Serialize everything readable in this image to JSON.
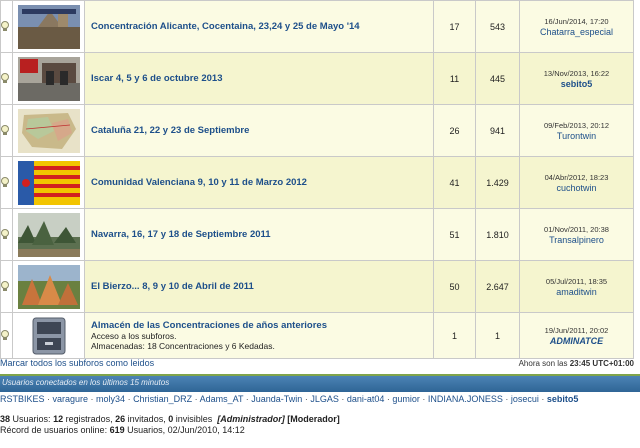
{
  "rows": [
    {
      "title": "Concentración Alicante, Cocentaina, 23,24 y 25 de Mayo '14",
      "topics": "17",
      "posts": "543",
      "date": "16/Jun/2014, 17:20",
      "user": "Chatarra_especial"
    },
    {
      "title": "Iscar 4, 5 y 6 de octubre 2013",
      "topics": "11",
      "posts": "445",
      "date": "13/Nov/2013, 16:22",
      "user": "sebito5"
    },
    {
      "title": "Cataluña 21, 22 y 23 de Septiembre",
      "topics": "26",
      "posts": "941",
      "date": "09/Feb/2013, 20:12",
      "user": "Turontwin"
    },
    {
      "title": "Comunidad Valenciana 9, 10 y 11 de Marzo 2012",
      "topics": "41",
      "posts": "1.429",
      "date": "04/Abr/2012, 18:23",
      "user": "cuchotwin"
    },
    {
      "title": "Navarra, 16, 17 y 18 de Septiembre 2011",
      "topics": "51",
      "posts": "1.810",
      "date": "01/Nov/2011, 20:38",
      "user": "Transalpinero"
    },
    {
      "title": "El Bierzo... 8, 9 y 10 de Abril de 2011",
      "topics": "50",
      "posts": "2.647",
      "date": "05/Jul/2011, 18:35",
      "user": "amaditwin"
    },
    {
      "title": "Almacén de las Concentraciones de años anteriores",
      "desc1": "Acceso a los subforos.",
      "desc2": "Almacenadas: 18 Concentraciones y 6 Kedadas.",
      "topics": "1",
      "posts": "1",
      "date": "19/Jun/2011, 20:02",
      "user": "ADMINATCE"
    }
  ],
  "footer": {
    "mark_all": "Marcar todos los subforos como leidos",
    "time_prefix": "Ahora son las",
    "time_value": "23:45 UTC+01:00"
  },
  "online": {
    "header": "Usuarios conectados en los últimos 15 minutos",
    "users": [
      "RSTBIKES",
      "varagure",
      "moly34",
      "Christian_DRZ",
      "Adams_AT",
      "Juanda-Twin",
      "JLGAS",
      "dani-at04",
      "gumior",
      "INDIANA.JONESS",
      "josecui",
      "sebito5"
    ],
    "separator": "·"
  },
  "stats": {
    "total": "38",
    "total_label": "Usuarios:",
    "registered": "12",
    "registered_label": "registrados,",
    "guests": "26",
    "guests_label": "invitados,",
    "invisible": "0",
    "invisible_label": "invisibles",
    "admin": "[Administrador]",
    "moderator": "[Moderador]",
    "record_label": "Récord de usuarios online:",
    "record_value": "619",
    "record_suffix": "Usuarios, 02/Jun/2010, 14:12"
  },
  "colors": {
    "link": "#1d4f8a",
    "row_a": "#fbfbe3",
    "row_b": "#f5f5cf",
    "online_bar": "#3a70a0"
  }
}
